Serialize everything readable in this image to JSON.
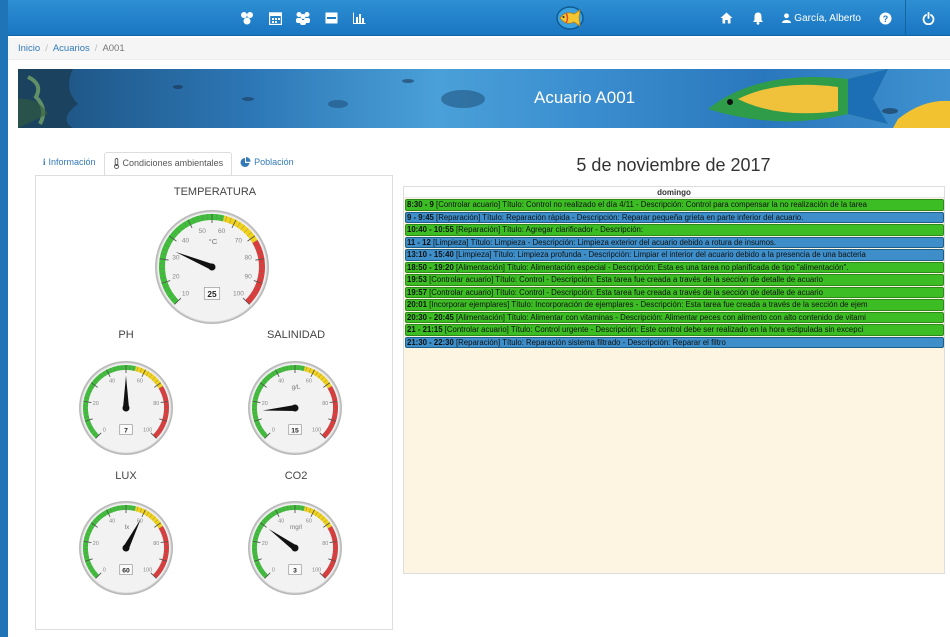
{
  "nav": {
    "left_icons": [
      "users-cog-icon",
      "calendar-icon",
      "group-icon",
      "inbox-icon",
      "bar-chart-icon"
    ],
    "user_name": "García, Alberto"
  },
  "breadcrumb": {
    "home": "Inicio",
    "section": "Acuarios",
    "current": "A001"
  },
  "banner": {
    "title": "Acuario A001"
  },
  "tabs": [
    {
      "label": "Información",
      "icon": "info-icon",
      "active": false
    },
    {
      "label": "Condiciones ambientales",
      "icon": "thermometer-icon",
      "active": true
    },
    {
      "label": "Población",
      "icon": "pie-chart-icon",
      "active": false
    }
  ],
  "gauges": {
    "temperatura": {
      "label": "TEMPERATURA",
      "value": 25,
      "unit": "°C",
      "ticks": [
        "10",
        "20",
        "30",
        "40",
        "50",
        "60",
        "70",
        "80",
        "90",
        "100"
      ]
    },
    "ph": {
      "label": "PH",
      "value": 7,
      "unit": "",
      "ticks": [
        "0",
        "20",
        "40",
        "60",
        "80",
        "100"
      ]
    },
    "salinidad": {
      "label": "SALINIDAD",
      "value": 15,
      "unit": "g/L",
      "ticks": [
        "0",
        "20",
        "40",
        "60",
        "80",
        "100"
      ]
    },
    "lux": {
      "label": "LUX",
      "value": 60,
      "unit": "lx",
      "ticks": [
        "0",
        "20",
        "40",
        "60",
        "80",
        "100"
      ]
    },
    "co2": {
      "label": "CO2",
      "value": 3,
      "unit": "mg/l",
      "ticks": [
        "0",
        "20",
        "40",
        "60",
        "80",
        "100"
      ]
    }
  },
  "schedule": {
    "date": "5 de noviembre de 2017",
    "day": "domingo",
    "events": [
      {
        "time": "8:30 - 9",
        "text": " [Controlar acuario] Título: Control no realizado el día 4/11 - Descripción: Control para compensar la no realización de la tarea",
        "color": "green"
      },
      {
        "time": "9 - 9:45",
        "text": " [Reparación] Título: Reparación rápida - Descripción: Reparar pequeña grieta en parte inferior del acuario.",
        "color": "blue"
      },
      {
        "time": "10:40 - 10:55",
        "text": " [Reparación] Título: Agregar clarificador - Descripción:",
        "color": "green"
      },
      {
        "time": "11 - 12",
        "text": " [Limpieza] Título: Limpieza - Descripción: Limpieza exterior del acuario debido a rotura de insumos.",
        "color": "blue"
      },
      {
        "time": "13:10 - 15:40",
        "text": " [Limpieza] Título: Limpieza profunda - Descripción: Limpiar el interior del acuario debido a la presencia de una bacteria",
        "color": "blue"
      },
      {
        "time": "18:50 - 19:20",
        "text": " [Alimentación] Título: Alimentación especial - Descripción: Esta es una tarea no planificada de tipo \"alimentación\".",
        "color": "green"
      },
      {
        "time": "19:53",
        "text": " [Controlar acuario] Título: Control - Descripción: Esta tarea fue creada a través de la sección de detalle de acuario",
        "color": "green"
      },
      {
        "time": "19:57",
        "text": " [Controlar acuario] Título: Control - Descripción: Esta tarea fue creada a través de la sección de detalle de acuario",
        "color": "green"
      },
      {
        "time": "20:01",
        "text": " [Incorporar ejemplares] Título: Incorporación de ejemplares - Descripción: Esta tarea fue creada a través de la sección de ejem",
        "color": "green"
      },
      {
        "time": "20:30 - 20:45",
        "text": " [Alimentación] Título: Alimentar con vitaminas - Descripción: Alimentar peces con alimento con alto contenido de vitami",
        "color": "green"
      },
      {
        "time": "21 - 21:15",
        "text": " [Controlar acuario] Título: Control urgente - Descripción: Este control debe ser realizado en la hora estipulada sin excepci",
        "color": "green"
      },
      {
        "time": "21:30 - 22:30",
        "text": " [Reparación] Título: Reparación sistema filtrado - Descripción: Reparar el filtro",
        "color": "blue"
      }
    ]
  }
}
